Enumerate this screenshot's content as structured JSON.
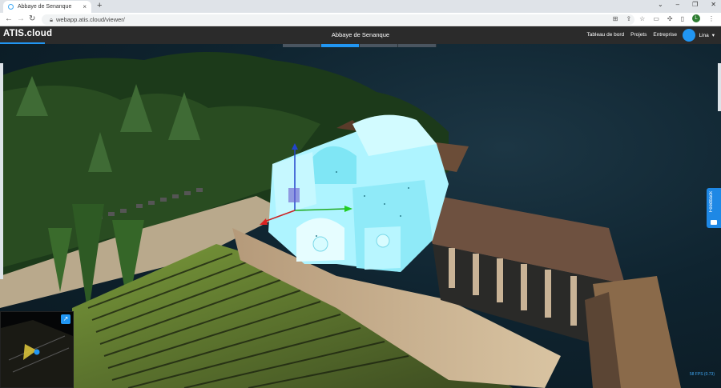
{
  "browser": {
    "tab_title": "Abbaye de Senanque",
    "tab_close": "×",
    "new_tab": "+",
    "url": "webapp.atis.cloud/viewer/",
    "profile_initial": "L",
    "window_controls": [
      "⌄",
      "–",
      "❐",
      "✕"
    ]
  },
  "app": {
    "logo": "ATIS.cloud",
    "project_title": "Abbaye de Senanque",
    "menu": [
      "Tableau de bord",
      "Projets",
      "Entreprise"
    ],
    "user_name": "Lina",
    "user_chevron": "▾"
  },
  "viewer": {
    "feedback_label": "Feedback",
    "fps": "58 FPS (0.73)"
  },
  "colors": {
    "accent": "#2196f3",
    "header_bg": "#2b2b2b",
    "model": "#9ef0ff"
  }
}
